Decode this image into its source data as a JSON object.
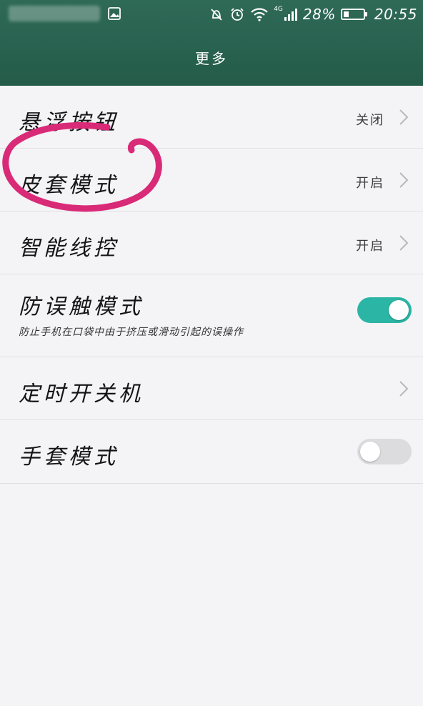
{
  "status_bar": {
    "network_label": "4G",
    "battery_percent": "28%",
    "battery_level": 0.28,
    "time": "20:55"
  },
  "header": {
    "title": "更多"
  },
  "settings": [
    {
      "title": "悬浮按钮",
      "value": "关闭",
      "control": "chevron"
    },
    {
      "title": "皮套模式",
      "value": "开启",
      "control": "chevron"
    },
    {
      "title": "智能线控",
      "value": "开启",
      "control": "chevron"
    },
    {
      "title": "防误触模式",
      "subtitle": "防止手机在口袋中由于挤压或滑动引起的误操作",
      "control": "toggle",
      "on": true
    },
    {
      "title": "定时开关机",
      "control": "chevron"
    },
    {
      "title": "手套模式",
      "control": "toggle",
      "on": false
    }
  ],
  "colors": {
    "header": "#2f6a57",
    "accent": "#2ab5a5",
    "annotation": "#d92a77"
  },
  "icons": [
    "gallery-icon",
    "alarm-off-icon",
    "alarm-icon",
    "wifi-icon",
    "signal-icon",
    "battery-icon",
    "chevron-right-icon"
  ]
}
